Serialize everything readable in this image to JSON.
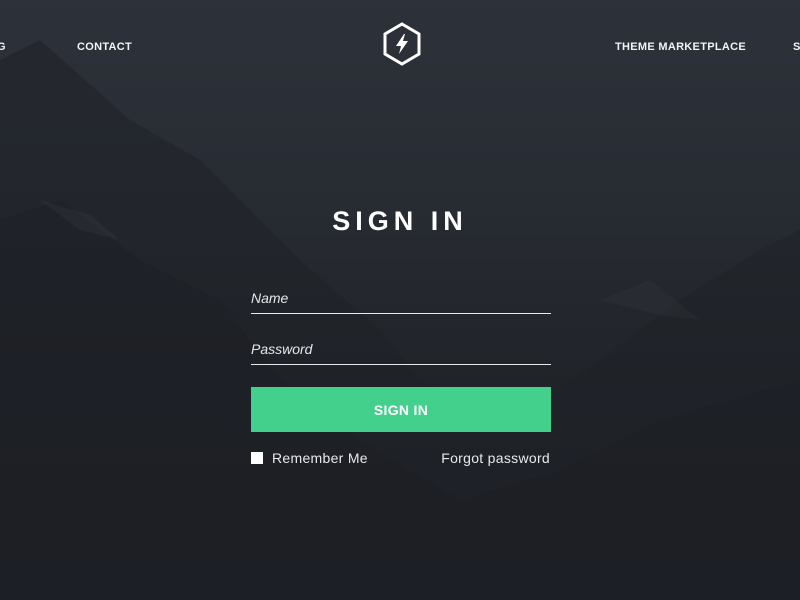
{
  "nav": {
    "left_cut_label": "G",
    "contact_label": "CONTACT",
    "theme_marketplace_label": "THEME MARKETPLACE",
    "right_cut_label": "S"
  },
  "logo": {
    "icon": "lightning-hexagon-icon"
  },
  "signin": {
    "title": "SIGN IN",
    "name_placeholder": "Name",
    "name_value": "",
    "password_placeholder": "Password",
    "password_value": "",
    "submit_label": "SIGN IN",
    "remember_label": "Remember Me",
    "remember_checked": false,
    "forgot_label": "Forgot password"
  },
  "colors": {
    "accent": "#43d08d",
    "background": "#272b32",
    "text": "#ffffff"
  }
}
